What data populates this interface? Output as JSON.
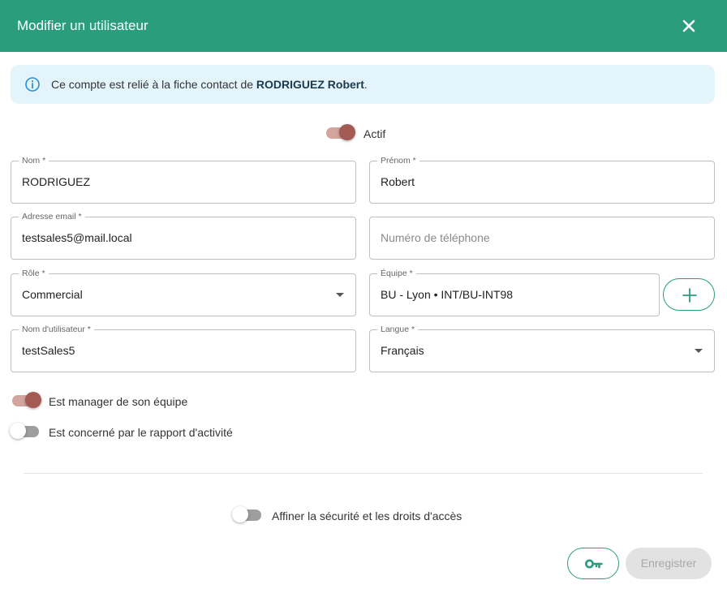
{
  "dialog": {
    "title": "Modifier un utilisateur",
    "close_icon": "close-icon"
  },
  "info": {
    "icon": "info-circle-icon",
    "text_prefix": "Ce compte est relié à la fiche contact de ",
    "contact_name": "RODRIGUEZ Robert",
    "text_suffix": "."
  },
  "active_toggle": {
    "label": "Actif",
    "checked": true
  },
  "fields": {
    "nom": {
      "label": "Nom *",
      "value": "RODRIGUEZ"
    },
    "prenom": {
      "label": "Prénom *",
      "value": "Robert"
    },
    "email": {
      "label": "Adresse email *",
      "value": "testsales5@mail.local"
    },
    "telephone": {
      "placeholder": "Numéro de téléphone",
      "value": ""
    },
    "role": {
      "label": "Rôle *",
      "value": "Commercial"
    },
    "equipe": {
      "label": "Équipe *",
      "value": "BU - Lyon • INT/BU-INT98"
    },
    "username": {
      "label": "Nom d'utilisateur *",
      "value": "testSales5"
    },
    "langue": {
      "label": "Langue *",
      "value": "Français"
    }
  },
  "toggles": {
    "manager": {
      "label": "Est manager de son équipe",
      "checked": true
    },
    "rapport": {
      "label": "Est concerné par le rapport d'activité",
      "checked": false
    },
    "securite": {
      "label": "Affiner la sécurité et les droits d'accès",
      "checked": false
    }
  },
  "footer": {
    "key_icon": "key-icon",
    "save_label": "Enregistrer"
  },
  "colors": {
    "header": "#2a9d7e",
    "accent": "#2a9d7e",
    "toggle_on_thumb": "#a35a52",
    "toggle_on_track": "#d4a49f",
    "info_bg": "#e3f4fa"
  }
}
